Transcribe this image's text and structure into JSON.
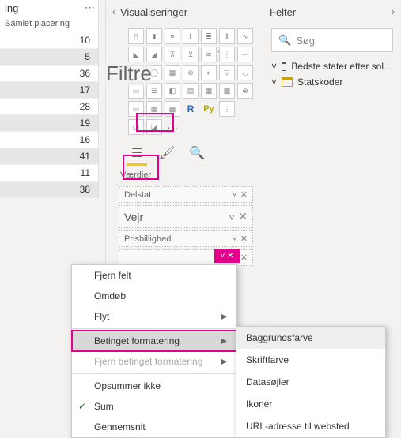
{
  "data_column": {
    "header_suffix": "ing",
    "subheader": "Samlet placering",
    "rows": [
      10,
      5,
      36,
      17,
      28,
      19,
      16,
      41,
      11,
      38
    ]
  },
  "viz_pane": {
    "title": "Visualiseringer",
    "filter_overlay": "Filtre",
    "values_label": "Værdier",
    "r_label": "R",
    "py_label": "Py",
    "more": "···",
    "wells": [
      {
        "label": "Delstat"
      },
      {
        "label": "Vejr"
      },
      {
        "label": "Prisbillighed"
      },
      {
        "label": ""
      }
    ]
  },
  "fields_pane": {
    "title": "Felter",
    "search_placeholder": "Søg",
    "tables": [
      "Bedste stater efter sol…",
      "Statskoder"
    ]
  },
  "context_menu": {
    "items": {
      "remove": "Fjern felt",
      "rename": "Omdøb",
      "move": "Flyt",
      "conditional": "Betinget formatering",
      "remove_cond": "Fjern betinget formatering",
      "dont_sum": "Opsummer ikke",
      "sum": "Sum",
      "avg": "Gennemsnit"
    }
  },
  "submenu": {
    "items": {
      "bg": "Baggrundsfarve",
      "font": "Skriftfarve",
      "bars": "Datasøjler",
      "icons": "Ikoner",
      "url": "URL-adresse til websted"
    }
  }
}
